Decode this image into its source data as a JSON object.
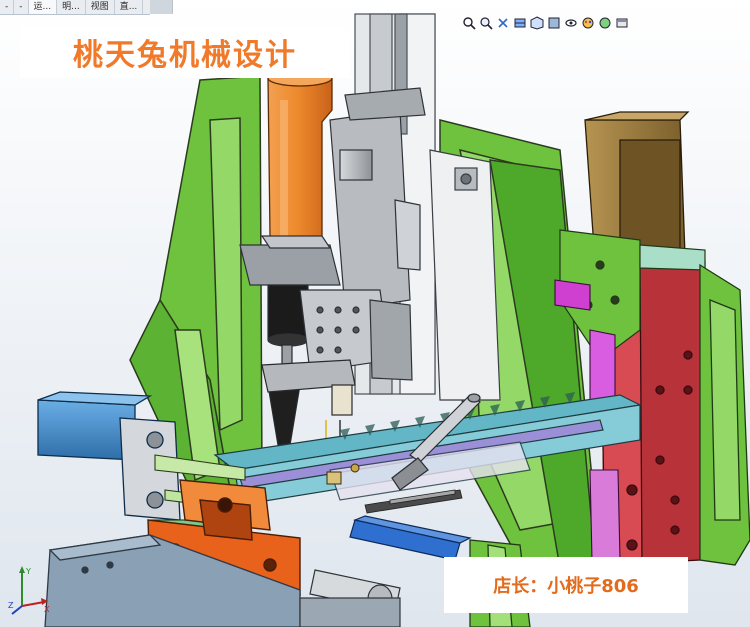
{
  "tabs": [
    {
      "label": "-"
    },
    {
      "label": "-"
    },
    {
      "label": "运..."
    },
    {
      "label": "明..."
    },
    {
      "label": "视图"
    },
    {
      "label": "直..."
    }
  ],
  "heads_up_toolbar": {
    "icons": [
      "zoom-to-fit-icon",
      "zoom-area-icon",
      "previous-view-icon",
      "section-view-icon",
      "view-orientation-icon",
      "display-style-icon",
      "hide-show-items-icon",
      "edit-appearance-icon",
      "apply-scene-icon",
      "view-settings-icon"
    ]
  },
  "overlay": {
    "title": "桃天兔机械设计",
    "shop_label": "店长：小桃子806"
  },
  "triad": {
    "axes": [
      "X",
      "Y",
      "Z"
    ]
  },
  "colors": {
    "frame_green": "#6fc23e",
    "spindle_orange": "#f0892e",
    "fixture_orange": "#e8621c",
    "column_red": "#b8323a",
    "motor_brown": "#9a7a3a",
    "cylinder_blue": "#3f86c8",
    "track_cyan": "#62b6c6",
    "base_steel": "#8aa0b4",
    "text_orange": "#f07a2a"
  }
}
